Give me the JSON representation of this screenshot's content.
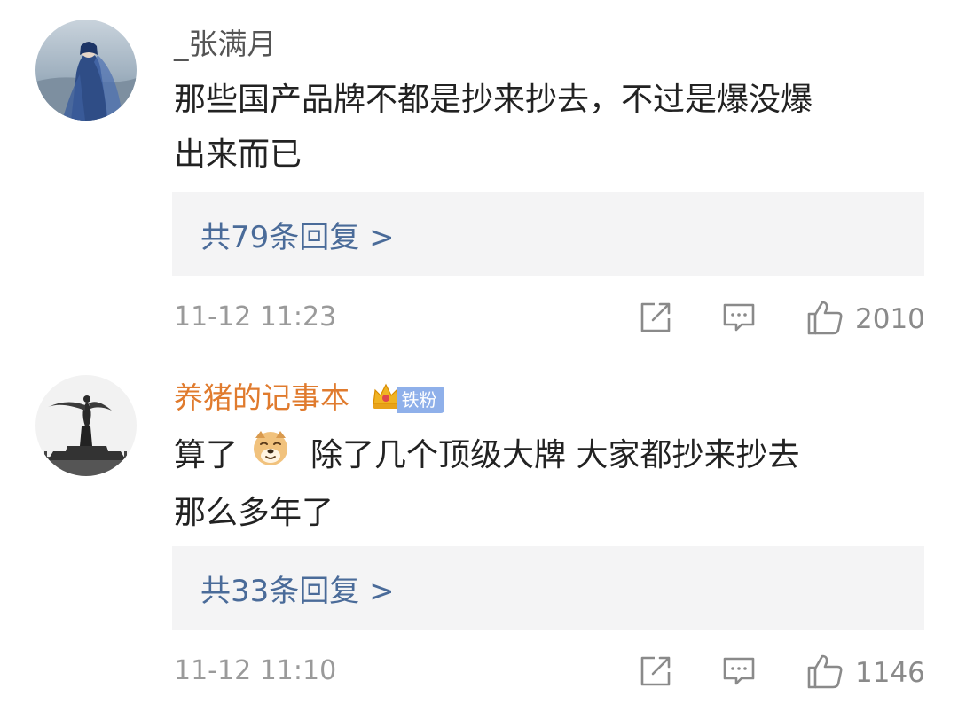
{
  "comments": [
    {
      "username": "_张满月",
      "text": "那些国产品牌不都是抄来抄去，不过是爆没爆出来而已",
      "text_line1": "那些国产品牌不都是抄来抄去，不过是爆没爆",
      "text_line2": "出来而已",
      "replies_label": "共79条回复 >",
      "time": "11-12 11:23",
      "likes": "2010",
      "username_color": "#555555"
    },
    {
      "username": "养猪的记事本",
      "badge_label": "铁粉",
      "text_line1_a": "算了",
      "text_line1_b": "除了几个顶级大牌 大家都抄来抄去",
      "text_line2": "那么多年了",
      "emoji_icon": "doge-emoji-icon",
      "replies_label": "共33条回复 >",
      "time": "11-12 11:10",
      "likes": "1146",
      "username_color": "#e07b2e"
    }
  ],
  "colors": {
    "reply_link": "#4a6b99",
    "reply_bg": "#f4f4f5",
    "meta_gray": "#9a9a9a",
    "badge_bg": "#8fb0ea"
  },
  "icons": [
    "share-icon",
    "comment-icon",
    "like-icon",
    "crown-icon"
  ]
}
